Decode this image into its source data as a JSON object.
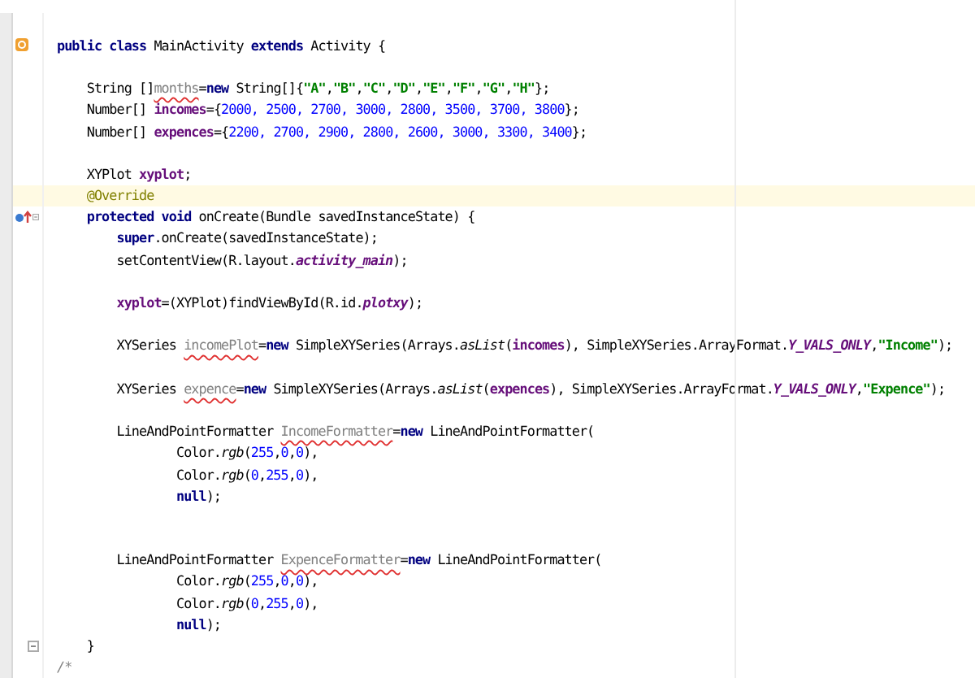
{
  "editor": {
    "lines": [
      {
        "kind": "blank",
        "current": false
      },
      {
        "kind": "code",
        "current": false,
        "class_marker": true,
        "tokens": [
          {
            "text": "public class ",
            "kind": "keyword"
          },
          {
            "text": "MainActivity ",
            "kind": "plain"
          },
          {
            "text": "extends ",
            "kind": "keyword"
          },
          {
            "text": "Activity {",
            "kind": "plain"
          }
        ]
      },
      {
        "kind": "blank",
        "current": false
      },
      {
        "kind": "code",
        "current": false,
        "tokens": [
          {
            "text": "    String []",
            "kind": "plain"
          },
          {
            "text": "months",
            "kind": "unused",
            "squiggle": true
          },
          {
            "text": "=",
            "kind": "plain"
          },
          {
            "text": "new ",
            "kind": "keyword"
          },
          {
            "text": "String[]{",
            "kind": "plain"
          },
          {
            "text": "\"A\"",
            "kind": "string"
          },
          {
            "text": ",",
            "kind": "plain"
          },
          {
            "text": "\"B\"",
            "kind": "string"
          },
          {
            "text": ",",
            "kind": "plain"
          },
          {
            "text": "\"C\"",
            "kind": "string"
          },
          {
            "text": ",",
            "kind": "plain"
          },
          {
            "text": "\"D\"",
            "kind": "string"
          },
          {
            "text": ",",
            "kind": "plain"
          },
          {
            "text": "\"E\"",
            "kind": "string"
          },
          {
            "text": ",",
            "kind": "plain"
          },
          {
            "text": "\"F\"",
            "kind": "string"
          },
          {
            "text": ",",
            "kind": "plain"
          },
          {
            "text": "\"G\"",
            "kind": "string"
          },
          {
            "text": ",",
            "kind": "plain"
          },
          {
            "text": "\"H\"",
            "kind": "string"
          },
          {
            "text": "};",
            "kind": "plain"
          }
        ]
      },
      {
        "kind": "code",
        "current": false,
        "tokens": [
          {
            "text": "    Number[] ",
            "kind": "plain"
          },
          {
            "text": "incomes",
            "kind": "field"
          },
          {
            "text": "={",
            "kind": "plain"
          },
          {
            "text": "2000, 2500, 2700, 3000, 2800, 3500, 3700, 3800",
            "kind": "number"
          },
          {
            "text": "};",
            "kind": "plain"
          }
        ]
      },
      {
        "kind": "code",
        "current": false,
        "tokens": [
          {
            "text": "    Number[] ",
            "kind": "plain"
          },
          {
            "text": "expences",
            "kind": "field"
          },
          {
            "text": "={",
            "kind": "plain"
          },
          {
            "text": "2200, 2700, 2900, 2800, 2600, 3000, 3300, 3400",
            "kind": "number"
          },
          {
            "text": "};",
            "kind": "plain"
          }
        ]
      },
      {
        "kind": "blank",
        "current": false
      },
      {
        "kind": "code",
        "current": false,
        "tokens": [
          {
            "text": "    XYPlot ",
            "kind": "plain"
          },
          {
            "text": "xyplot",
            "kind": "field"
          },
          {
            "text": ";",
            "kind": "plain"
          }
        ]
      },
      {
        "kind": "code",
        "current": true,
        "tokens": [
          {
            "text": "    @Override",
            "kind": "annotation"
          }
        ]
      },
      {
        "kind": "code",
        "current": false,
        "override_marker": true,
        "fold": true,
        "tokens": [
          {
            "text": "    protected void ",
            "kind": "keyword"
          },
          {
            "text": "onCreate(Bundle savedInstanceState) {",
            "kind": "plain"
          }
        ]
      },
      {
        "kind": "code",
        "current": false,
        "tokens": [
          {
            "text": "        super",
            "kind": "keyword"
          },
          {
            "text": ".onCreate(savedInstanceState);",
            "kind": "plain"
          }
        ]
      },
      {
        "kind": "code",
        "current": false,
        "tokens": [
          {
            "text": "        setContentView(R.layout.",
            "kind": "plain"
          },
          {
            "text": "activity_main",
            "kind": "static"
          },
          {
            "text": ");",
            "kind": "plain"
          }
        ]
      },
      {
        "kind": "blank",
        "current": false
      },
      {
        "kind": "code",
        "current": false,
        "tokens": [
          {
            "text": "        xyplot",
            "kind": "field"
          },
          {
            "text": "=(XYPlot)findViewById(R.id.",
            "kind": "plain"
          },
          {
            "text": "plotxy",
            "kind": "static"
          },
          {
            "text": ");",
            "kind": "plain"
          }
        ]
      },
      {
        "kind": "blank",
        "current": false
      },
      {
        "kind": "code",
        "current": false,
        "tokens": [
          {
            "text": "        XYSeries ",
            "kind": "plain"
          },
          {
            "text": "incomePlot",
            "kind": "unused",
            "squiggle": true
          },
          {
            "text": "=",
            "kind": "plain"
          },
          {
            "text": "new ",
            "kind": "keyword"
          },
          {
            "text": "SimpleXYSeries(Arrays.",
            "kind": "plain"
          },
          {
            "text": "asList",
            "kind": "method"
          },
          {
            "text": "(",
            "kind": "plain"
          },
          {
            "text": "incomes",
            "kind": "field"
          },
          {
            "text": "), SimpleXYSeries.ArrayFormat.",
            "kind": "plain"
          },
          {
            "text": "Y_VALS_ONLY",
            "kind": "static"
          },
          {
            "text": ",",
            "kind": "plain"
          },
          {
            "text": "\"Income\"",
            "kind": "string"
          },
          {
            "text": ");",
            "kind": "plain"
          }
        ]
      },
      {
        "kind": "blank",
        "current": false
      },
      {
        "kind": "code",
        "current": false,
        "tokens": [
          {
            "text": "        XYSeries ",
            "kind": "plain"
          },
          {
            "text": "expence",
            "kind": "unused",
            "squiggle": true
          },
          {
            "text": "=",
            "kind": "plain"
          },
          {
            "text": "new ",
            "kind": "keyword"
          },
          {
            "text": "SimpleXYSeries(Arrays.",
            "kind": "plain"
          },
          {
            "text": "asList",
            "kind": "method"
          },
          {
            "text": "(",
            "kind": "plain"
          },
          {
            "text": "expences",
            "kind": "field"
          },
          {
            "text": "), SimpleXYSeries.ArrayFormat.",
            "kind": "plain"
          },
          {
            "text": "Y_VALS_ONLY",
            "kind": "static"
          },
          {
            "text": ",",
            "kind": "plain"
          },
          {
            "text": "\"Expence\"",
            "kind": "string"
          },
          {
            "text": ");",
            "kind": "plain"
          }
        ]
      },
      {
        "kind": "blank",
        "current": false
      },
      {
        "kind": "code",
        "current": false,
        "tokens": [
          {
            "text": "        LineAndPointFormatter ",
            "kind": "plain"
          },
          {
            "text": "IncomeFormatter",
            "kind": "unused",
            "squiggle": true
          },
          {
            "text": "=",
            "kind": "plain"
          },
          {
            "text": "new ",
            "kind": "keyword"
          },
          {
            "text": "LineAndPointFormatter(",
            "kind": "plain"
          }
        ]
      },
      {
        "kind": "code",
        "current": false,
        "tokens": [
          {
            "text": "                Color.",
            "kind": "plain"
          },
          {
            "text": "rgb",
            "kind": "method"
          },
          {
            "text": "(",
            "kind": "plain"
          },
          {
            "text": "255",
            "kind": "number"
          },
          {
            "text": ",",
            "kind": "plain"
          },
          {
            "text": "0",
            "kind": "number"
          },
          {
            "text": ",",
            "kind": "plain"
          },
          {
            "text": "0",
            "kind": "number"
          },
          {
            "text": "),",
            "kind": "plain"
          }
        ]
      },
      {
        "kind": "code",
        "current": false,
        "tokens": [
          {
            "text": "                Color.",
            "kind": "plain"
          },
          {
            "text": "rgb",
            "kind": "method"
          },
          {
            "text": "(",
            "kind": "plain"
          },
          {
            "text": "0",
            "kind": "number"
          },
          {
            "text": ",",
            "kind": "plain"
          },
          {
            "text": "255",
            "kind": "number"
          },
          {
            "text": ",",
            "kind": "plain"
          },
          {
            "text": "0",
            "kind": "number"
          },
          {
            "text": "),",
            "kind": "plain"
          }
        ]
      },
      {
        "kind": "code",
        "current": false,
        "tokens": [
          {
            "text": "                null",
            "kind": "keyword"
          },
          {
            "text": ");",
            "kind": "plain"
          }
        ]
      },
      {
        "kind": "blank",
        "current": false
      },
      {
        "kind": "blank",
        "current": false
      },
      {
        "kind": "code",
        "current": false,
        "tokens": [
          {
            "text": "        LineAndPointFormatter ",
            "kind": "plain"
          },
          {
            "text": "ExpenceFormatter",
            "kind": "unused",
            "squiggle": true
          },
          {
            "text": "=",
            "kind": "plain"
          },
          {
            "text": "new ",
            "kind": "keyword"
          },
          {
            "text": "LineAndPointFormatter(",
            "kind": "plain"
          }
        ]
      },
      {
        "kind": "code",
        "current": false,
        "tokens": [
          {
            "text": "                Color.",
            "kind": "plain"
          },
          {
            "text": "rgb",
            "kind": "method"
          },
          {
            "text": "(",
            "kind": "plain"
          },
          {
            "text": "255",
            "kind": "number"
          },
          {
            "text": ",",
            "kind": "plain"
          },
          {
            "text": "0",
            "kind": "number"
          },
          {
            "text": ",",
            "kind": "plain"
          },
          {
            "text": "0",
            "kind": "number"
          },
          {
            "text": "),",
            "kind": "plain"
          }
        ]
      },
      {
        "kind": "code",
        "current": false,
        "tokens": [
          {
            "text": "                Color.",
            "kind": "plain"
          },
          {
            "text": "rgb",
            "kind": "method"
          },
          {
            "text": "(",
            "kind": "plain"
          },
          {
            "text": "0",
            "kind": "number"
          },
          {
            "text": ",",
            "kind": "plain"
          },
          {
            "text": "255",
            "kind": "number"
          },
          {
            "text": ",",
            "kind": "plain"
          },
          {
            "text": "0",
            "kind": "number"
          },
          {
            "text": "),",
            "kind": "plain"
          }
        ]
      },
      {
        "kind": "code",
        "current": false,
        "tokens": [
          {
            "text": "                null",
            "kind": "keyword"
          },
          {
            "text": ");",
            "kind": "plain"
          }
        ]
      },
      {
        "kind": "code",
        "current": false,
        "fold": true,
        "tokens": [
          {
            "text": "    }",
            "kind": "plain"
          }
        ]
      },
      {
        "kind": "code",
        "current": false,
        "tokens": [
          {
            "text": "/*",
            "kind": "comment"
          }
        ]
      }
    ]
  }
}
